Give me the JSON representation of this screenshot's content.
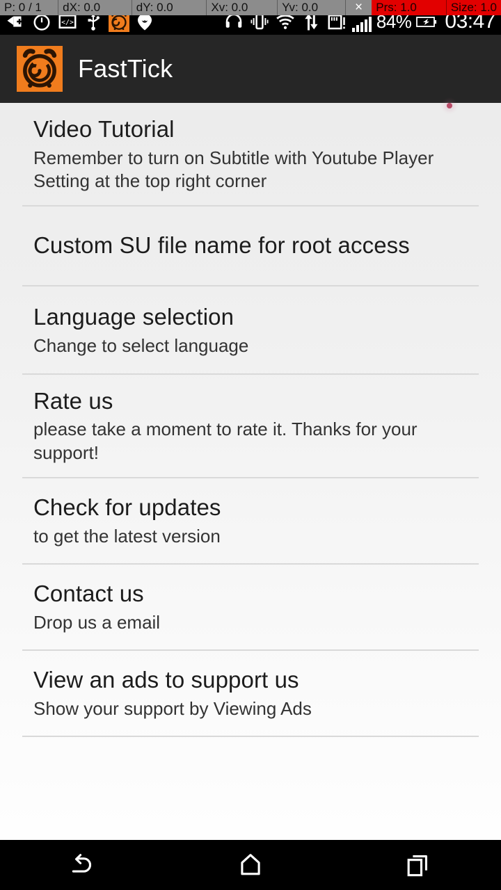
{
  "pointer_overlay": {
    "pointer_count": "P: 0 / 1",
    "dx": "dX: 0.0",
    "dy": "dY: 0.0",
    "xv": "Xv: 0.0",
    "yv": "Yv: 0.0",
    "close_mark": "×",
    "prs": "Prs: 1.0",
    "size": "Size: 1.0",
    "bg_color": "#8c8c8c",
    "highlight_color": "#e20000"
  },
  "status_bar": {
    "battery": "84%",
    "clock": "03:47",
    "left_icons": [
      "add-note-icon",
      "stopwatch-icon",
      "code-screenshot-icon",
      "usb-icon",
      "fasttick-app-icon",
      "location-pin-icon"
    ],
    "right_icons": [
      "headset-icon",
      "vibrate-icon",
      "wifi-icon",
      "data-transfer-icon",
      "sd-card-warning-icon",
      "signal-bars-icon",
      "battery-icon"
    ]
  },
  "app_bar": {
    "title": "FastTick",
    "logo_icon": "alarm-clock-icon",
    "background": "#262626",
    "accent": "#f07c1d"
  },
  "settings_list": [
    {
      "title": "Video Tutorial",
      "subtitle": "Remember to turn on Subtitle with Youtube Player Setting at the top right corner"
    },
    {
      "title": "Custom SU file name for root access",
      "subtitle": ""
    },
    {
      "title": "Language selection",
      "subtitle": "Change to select language"
    },
    {
      "title": "Rate us",
      "subtitle": "please take a moment to rate it. Thanks for your support!"
    },
    {
      "title": "Check for updates",
      "subtitle": "to get the latest version"
    },
    {
      "title": "Contact us",
      "subtitle": "Drop us a email"
    },
    {
      "title": "View an ads to support us",
      "subtitle": "Show your support by Viewing Ads"
    }
  ],
  "nav_bar": {
    "back": "back-icon",
    "home": "home-icon",
    "recents": "recent-apps-icon"
  }
}
